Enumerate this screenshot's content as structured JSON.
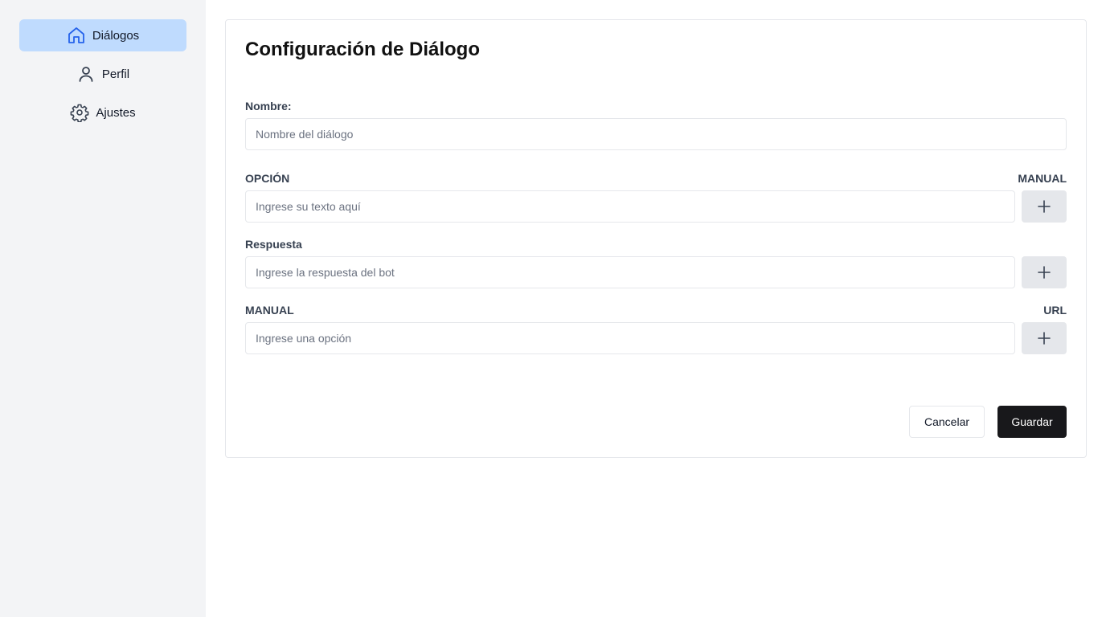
{
  "sidebar": {
    "items": [
      {
        "label": "Diálogos",
        "icon": "home-icon",
        "active": true
      },
      {
        "label": "Perfil",
        "icon": "user-icon",
        "active": false
      },
      {
        "label": "Ajustes",
        "icon": "gear-icon",
        "active": false
      }
    ]
  },
  "form": {
    "title": "Configuración de Diálogo",
    "name": {
      "label": "Nombre:",
      "placeholder": "Nombre del diálogo",
      "value": ""
    },
    "option": {
      "label_left": "OPCIÓN",
      "label_right": "MANUAL",
      "placeholder": "Ingrese su texto aquí",
      "value": ""
    },
    "response": {
      "label_left": "Respuesta",
      "placeholder": "Ingrese la respuesta del bot",
      "value": ""
    },
    "manual": {
      "label_left": "MANUAL",
      "label_right": "URL",
      "placeholder": "Ingrese una opción",
      "value": ""
    },
    "cancel_label": "Cancelar",
    "save_label": "Guardar"
  },
  "colors": {
    "sidebar_bg": "#f3f4f6",
    "active_nav_bg": "#bfdbfe",
    "active_icon": "#2563eb",
    "save_button_bg": "#18181b",
    "add_button_bg": "#e5e7eb"
  }
}
